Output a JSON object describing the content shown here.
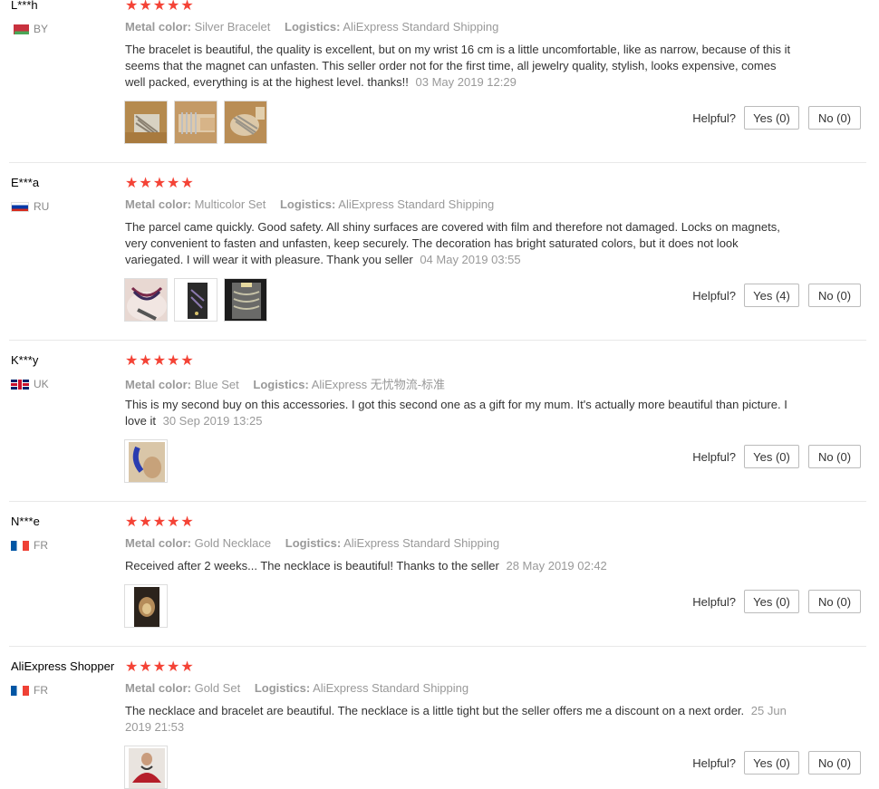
{
  "labels": {
    "metal_color": "Metal color:",
    "logistics": "Logistics:",
    "helpful": "Helpful?"
  },
  "reviews": [
    {
      "name": "L***h",
      "country": "BY",
      "stars": "★★★★★",
      "metal_color": "Silver Bracelet",
      "logistics": "AliExpress Standard Shipping",
      "text": "The bracelet is beautiful, the quality is excellent, but on my wrist 16 cm is a little uncomfortable, like as narrow, because of this it seems that the magnet can unfasten. This seller order not for the first time, all jewelry quality, stylish, looks expensive, comes well packed, everything is at the highest level. thanks!!",
      "date": "03 May 2019 12:29",
      "yes": "Yes (0)",
      "no": "No (0)"
    },
    {
      "name": "E***a",
      "country": "RU",
      "stars": "★★★★★",
      "metal_color": "Multicolor Set",
      "logistics": "AliExpress Standard Shipping",
      "text": "The parcel came quickly. Good safety. All shiny surfaces are covered with film and therefore not damaged. Locks on magnets, very convenient to fasten and unfasten, keep securely. The decoration has bright saturated colors, but it does not look variegated. I will wear it with pleasure. Thank you seller",
      "date": "04 May 2019 03:55",
      "yes": "Yes (4)",
      "no": "No (0)"
    },
    {
      "name": "K***y",
      "country": "UK",
      "stars": "★★★★★",
      "metal_color": "Blue Set",
      "logistics": "AliExpress 无忧物流-标准",
      "text": "This is my second buy on this accessories. I got this second one as a gift for my mum. It's actually more beautiful than picture. I love it",
      "date": "30 Sep 2019 13:25",
      "yes": "Yes (0)",
      "no": "No (0)"
    },
    {
      "name": "N***e",
      "country": "FR",
      "stars": "★★★★★",
      "metal_color": "Gold Necklace",
      "logistics": "AliExpress Standard Shipping",
      "text": "Received after 2 weeks... The necklace is beautiful! Thanks to the seller",
      "date": "28 May 2019 02:42",
      "yes": "Yes (0)",
      "no": "No (0)"
    },
    {
      "name": "AliExpress Shopper",
      "country": "FR",
      "stars": "★★★★★",
      "metal_color": "Gold Set",
      "logistics": "AliExpress Standard Shipping",
      "text": "The necklace and bracelet are beautiful. The necklace is a little tight but the seller offers me a discount on a next order.",
      "date": "25 Jun 2019 21:53",
      "yes": "Yes (0)",
      "no": "No (0)"
    }
  ]
}
